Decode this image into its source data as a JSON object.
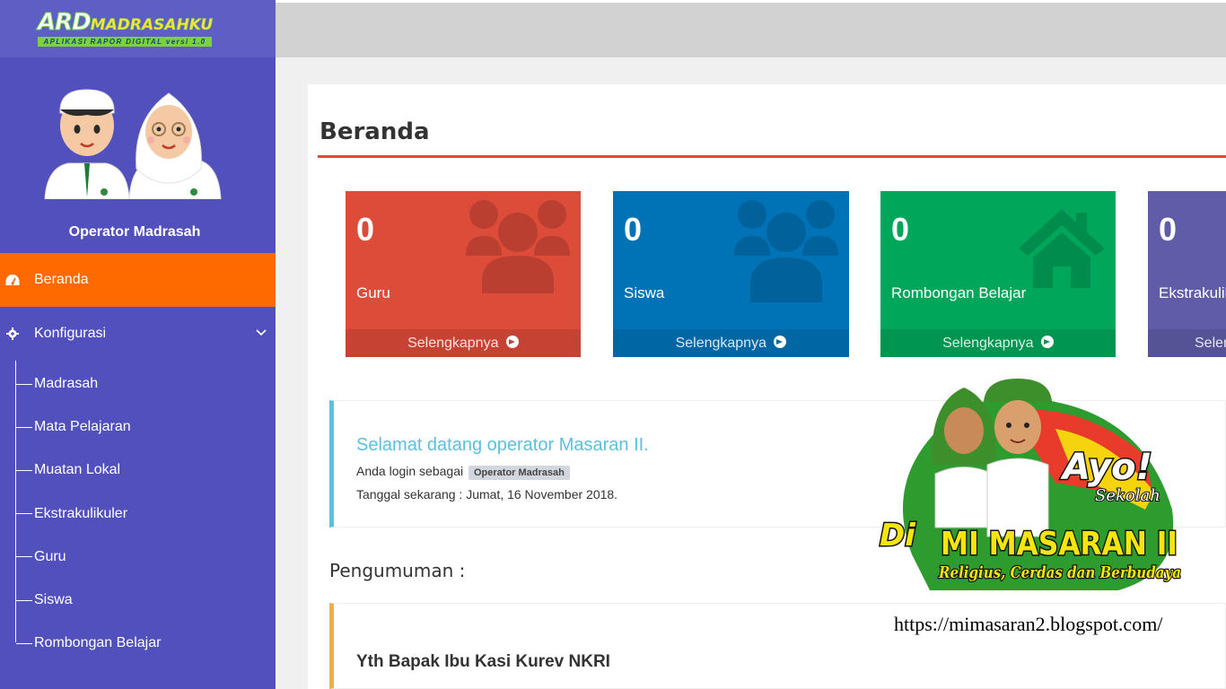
{
  "brand": {
    "title": "ARD",
    "subtitle": "MADRASAHKU",
    "tagline": "APLIKASI RAPOR DIGITAL versi 1.0"
  },
  "user": {
    "name": "Operator Madrasah"
  },
  "menu": {
    "beranda": "Beranda",
    "konfigurasi": "Konfigurasi",
    "sub": [
      "Madrasah",
      "Mata Pelajaran",
      "Muatan Lokal",
      "Ekstrakulikuler",
      "Guru",
      "Siswa",
      "Rombongan Belajar"
    ]
  },
  "page": {
    "title": "Beranda"
  },
  "stats": [
    {
      "value": "0",
      "label": "Guru",
      "more": "Selengkapnya",
      "color": "#dd4b39",
      "icon": "users-icon"
    },
    {
      "value": "0",
      "label": "Siswa",
      "more": "Selengkapnya",
      "color": "#0073b7",
      "icon": "users-icon"
    },
    {
      "value": "0",
      "label": "Rombongan Belajar",
      "more": "Selengkapnya",
      "color": "#00a65a",
      "icon": "home-icon"
    },
    {
      "value": "0",
      "label": "Ekstrakulikuler",
      "more": "Selengkapnya",
      "color": "#605ca8",
      "icon": ""
    }
  ],
  "welcome": {
    "heading": "Selamat datang operator Masaran II.",
    "login_text": "Anda login sebagai",
    "role_badge": "Operator Madrasah",
    "date_text": "Tanggal sekarang : Jumat, 16 November 2018."
  },
  "announcements": {
    "title": "Pengumuman :",
    "first_heading": "Yth Bapak Ibu Kasi Kurev NKRI"
  },
  "promo": {
    "ayo": "Ayo!",
    "sekolah": "Sekolah",
    "di": "Di",
    "school": "MI MASARAN II",
    "motto": "Religius, Cerdas dan Berbudaya",
    "url": "https://mimasaran2.blogspot.com/"
  }
}
